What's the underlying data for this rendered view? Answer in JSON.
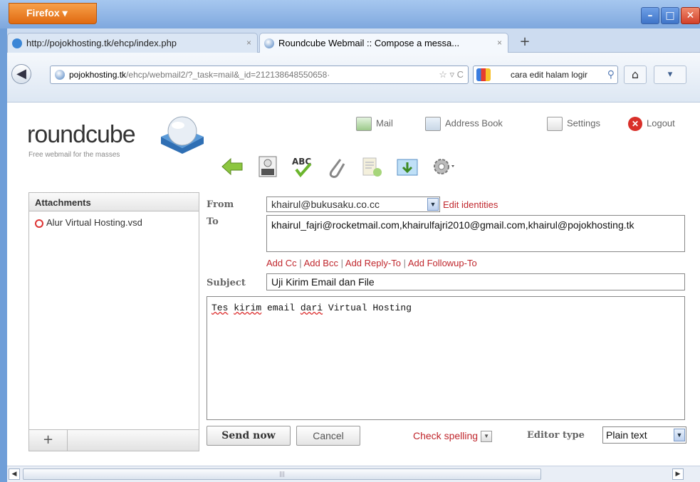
{
  "browser": {
    "menu_label": "Firefox ▾",
    "tabs": [
      {
        "title": "http://pojokhosting.tk/ehcp/index.php",
        "close": "×"
      },
      {
        "title": "Roundcube Webmail :: Compose a messa...",
        "close": "×"
      }
    ],
    "new_tab": "+",
    "back": "◀",
    "url_domain": "pojokhosting.tk",
    "url_path": "/ehcp/webmail2/?_task=mail&_id=212138648550658·",
    "url_icons": "☆ ▿ C",
    "search_text": "cara edit halam logir",
    "search_go": "⚲",
    "home": "⌂",
    "bookmarks": "▾"
  },
  "header": {
    "logo": "roundcube",
    "tagline": "Free webmail for the masses",
    "nav": [
      {
        "label": "Mail"
      },
      {
        "label": "Address Book"
      },
      {
        "label": "Settings"
      },
      {
        "label": "Logout"
      }
    ]
  },
  "attachments": {
    "title": "Attachments",
    "items": [
      {
        "name": "Alur Virtual Hosting.vsd"
      }
    ],
    "add": "+"
  },
  "compose": {
    "from_label": "From",
    "from_value": "khairul@bukusaku.co.cc",
    "edit_identities": "Edit identities",
    "to_label": "To",
    "to_value": "khairul_fajri@rocketmail.com,khairulfajri2010@gmail.com,khairul@pojokhosting.tk",
    "add_cc": "Add Cc",
    "add_bcc": "Add Bcc",
    "add_reply_to": "Add Reply-To",
    "add_followup_to": "Add Followup-To",
    "sep": "|",
    "subject_label": "Subject",
    "subject_value": "Uji Kirim Email dan File",
    "body_words": [
      "Tes",
      "kirim",
      "email",
      "dari",
      "Virtual",
      "Hosting"
    ]
  },
  "footer": {
    "send": "Send now",
    "cancel": "Cancel",
    "check_spelling": "Check spelling",
    "editor_type_label": "Editor type",
    "editor_type_value": "Plain text"
  },
  "colors": {
    "accent": "#c0272d",
    "title_bar": "#7fa8de",
    "firefox_button": "#e06a10"
  }
}
